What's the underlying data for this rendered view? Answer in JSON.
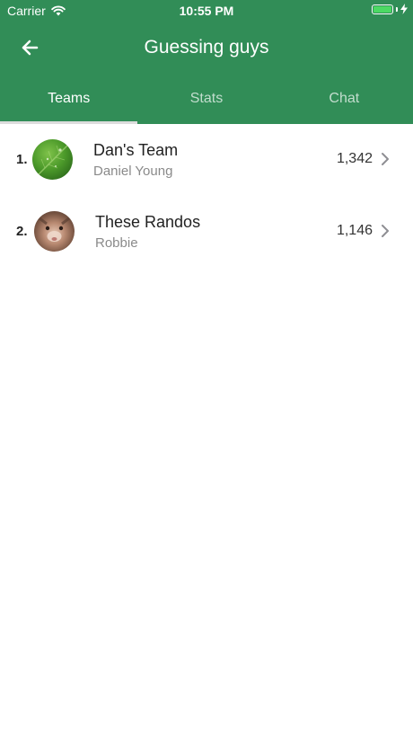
{
  "status_bar": {
    "carrier": "Carrier",
    "time": "10:55 PM"
  },
  "nav": {
    "title": "Guessing guys",
    "back_icon": "arrow-left-icon"
  },
  "tabs": [
    {
      "label": "Teams",
      "active": true
    },
    {
      "label": "Stats",
      "active": false
    },
    {
      "label": "Chat",
      "active": false
    }
  ],
  "teams": [
    {
      "rank": "1.",
      "name": "Dan's Team",
      "captain": "Daniel Young",
      "score": "1,342"
    },
    {
      "rank": "2.",
      "name": "These Randos",
      "captain": "Robbie",
      "score": "1,146"
    }
  ],
  "colors": {
    "header": "#318d57",
    "tab_indicator": "#dcdcdc",
    "battery": "#4cd964"
  }
}
